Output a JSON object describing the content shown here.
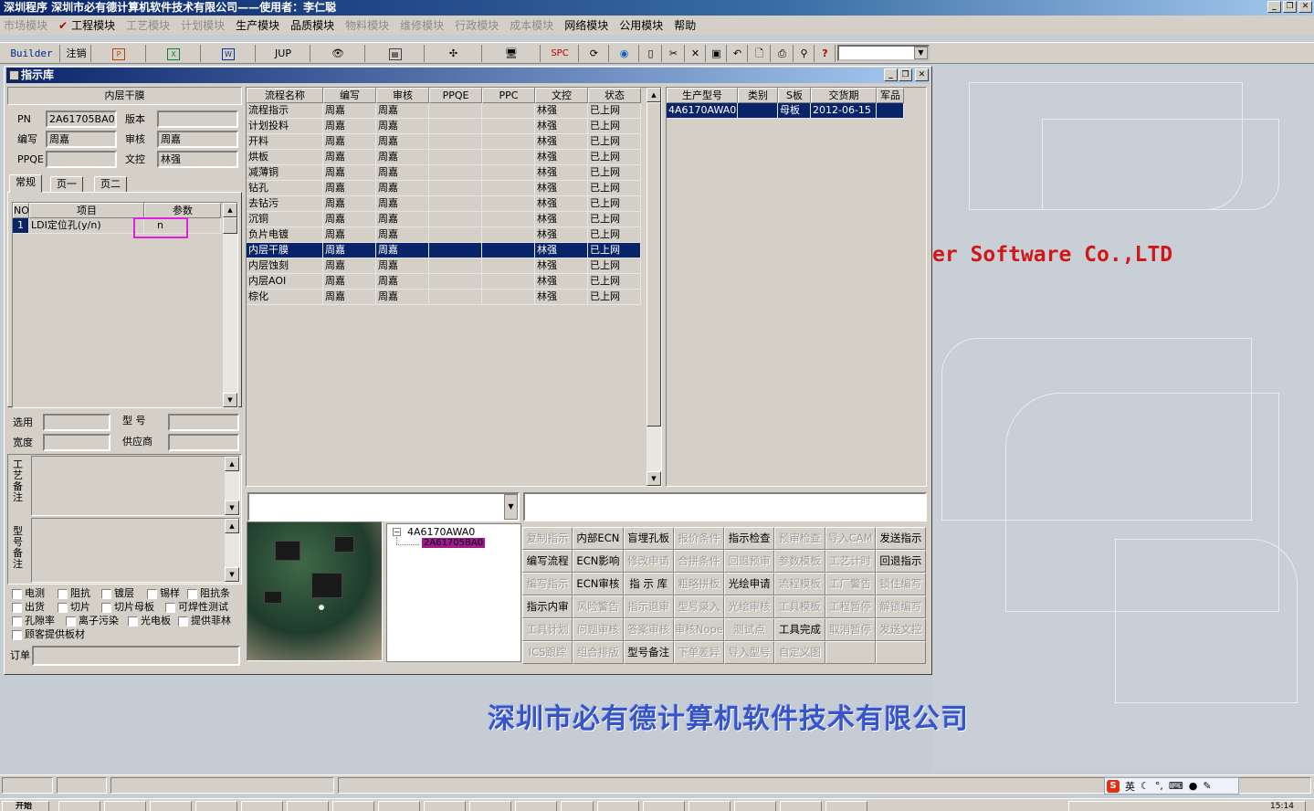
{
  "app": {
    "title": "深圳程序    深圳市必有德计算机软件技术有限公司——使用者：李仁聪"
  },
  "menu": {
    "items": [
      {
        "label": "市场模块",
        "disabled": true
      },
      {
        "label": "工程模块",
        "disabled": false,
        "checked": true
      },
      {
        "label": "工艺模块",
        "disabled": true
      },
      {
        "label": "计划模块",
        "disabled": true
      },
      {
        "label": "生产模块",
        "disabled": false
      },
      {
        "label": "品质模块",
        "disabled": false
      },
      {
        "label": "物料模块",
        "disabled": true
      },
      {
        "label": "维修模块",
        "disabled": true
      },
      {
        "label": "行政模块",
        "disabled": true
      },
      {
        "label": "成本模块",
        "disabled": true
      },
      {
        "label": "网络模块",
        "disabled": false
      },
      {
        "label": "公用模块",
        "disabled": false
      },
      {
        "label": "帮助",
        "disabled": false
      }
    ]
  },
  "toolbar": {
    "builder": "Builder",
    "logout": "注销",
    "jup": "JUP",
    "spc": "SPC"
  },
  "window": {
    "title": "指示库"
  },
  "left": {
    "section_title": "内层干膜",
    "pn_label": "PN",
    "pn_value": "2A61705BA0",
    "version_label": "版本",
    "version_value": "",
    "author_label": "编写",
    "author_value": "周嘉",
    "review_label": "审核",
    "review_value": "周嘉",
    "ppqe_label": "PPQE",
    "ppqe_value": "",
    "doc_label": "文控",
    "doc_value": "林强",
    "tabs": [
      "常规",
      "页一",
      "页二"
    ],
    "param_headers": [
      "NO",
      "项目",
      "参数"
    ],
    "param_rows": [
      {
        "no": "1",
        "item": "LDI定位孔(y/n)",
        "param": "n"
      }
    ],
    "select_label": "选用",
    "model_label": "型 号",
    "width_label": "宽度",
    "supplier_label": "供应商",
    "process_note_label": "工艺备注",
    "model_note_label": "型号备注",
    "checkboxes": [
      "电测",
      "阻抗",
      "镀层",
      "锡样",
      "阻抗条",
      "出货",
      "切片",
      "切片母板",
      "可焊性测试",
      "孔隙率",
      "离子污染",
      "光电板",
      "提供菲林",
      "顾客提供板材"
    ],
    "order_label": "订单"
  },
  "process_grid": {
    "headers": [
      "流程名称",
      "编写",
      "审核",
      "PPQE",
      "PPC",
      "文控",
      "状态"
    ],
    "rows": [
      [
        "流程指示",
        "周嘉",
        "周嘉",
        "",
        "",
        "林强",
        "已上网"
      ],
      [
        "计划投料",
        "周嘉",
        "周嘉",
        "",
        "",
        "林强",
        "已上网"
      ],
      [
        "开料",
        "周嘉",
        "周嘉",
        "",
        "",
        "林强",
        "已上网"
      ],
      [
        "烘板",
        "周嘉",
        "周嘉",
        "",
        "",
        "林强",
        "已上网"
      ],
      [
        "减薄铜",
        "周嘉",
        "周嘉",
        "",
        "",
        "林强",
        "已上网"
      ],
      [
        "钻孔",
        "周嘉",
        "周嘉",
        "",
        "",
        "林强",
        "已上网"
      ],
      [
        "去钻污",
        "周嘉",
        "周嘉",
        "",
        "",
        "林强",
        "已上网"
      ],
      [
        "沉铜",
        "周嘉",
        "周嘉",
        "",
        "",
        "林强",
        "已上网"
      ],
      [
        "负片电镀",
        "周嘉",
        "周嘉",
        "",
        "",
        "林强",
        "已上网"
      ],
      [
        "内层干膜",
        "周嘉",
        "周嘉",
        "",
        "",
        "林强",
        "已上网"
      ],
      [
        "内层蚀刻",
        "周嘉",
        "周嘉",
        "",
        "",
        "林强",
        "已上网"
      ],
      [
        "内层AOI",
        "周嘉",
        "周嘉",
        "",
        "",
        "林强",
        "已上网"
      ],
      [
        "棕化",
        "周嘉",
        "周嘉",
        "",
        "",
        "林强",
        "已上网"
      ]
    ],
    "selected_index": 9
  },
  "product_grid": {
    "headers": [
      "生产型号",
      "类别",
      "S板",
      "交货期",
      "军品"
    ],
    "rows": [
      [
        "4A6170AWA0",
        "",
        "母板",
        "2012-06-15",
        ""
      ]
    ]
  },
  "tree": {
    "root": "4A6170AWA0",
    "child": "2A61705BA0"
  },
  "buttons": [
    {
      "label": "复制指示",
      "enabled": false
    },
    {
      "label": "内部ECN",
      "enabled": true
    },
    {
      "label": "盲埋孔板",
      "enabled": true
    },
    {
      "label": "报价条件",
      "enabled": false
    },
    {
      "label": "指示检查",
      "enabled": true
    },
    {
      "label": "预审检查",
      "enabled": false
    },
    {
      "label": "导入CAM",
      "enabled": false
    },
    {
      "label": "发送指示",
      "enabled": true
    },
    {
      "label": "编写流程",
      "enabled": true
    },
    {
      "label": "ECN影响",
      "enabled": true
    },
    {
      "label": "修改申请",
      "enabled": false
    },
    {
      "label": "合拼条件",
      "enabled": false
    },
    {
      "label": "回退预审",
      "enabled": false
    },
    {
      "label": "参数模板",
      "enabled": false
    },
    {
      "label": "工艺计时",
      "enabled": false
    },
    {
      "label": "回退指示",
      "enabled": true
    },
    {
      "label": "编写指示",
      "enabled": false
    },
    {
      "label": "ECN审核",
      "enabled": true
    },
    {
      "label": "指 示 库",
      "enabled": true
    },
    {
      "label": "粗略拼板",
      "enabled": false
    },
    {
      "label": "光绘申请",
      "enabled": true
    },
    {
      "label": "流程模板",
      "enabled": false
    },
    {
      "label": "工厂警告",
      "enabled": false
    },
    {
      "label": "锁住编写",
      "enabled": false
    },
    {
      "label": "指示内审",
      "enabled": true
    },
    {
      "label": "风险警告",
      "enabled": false
    },
    {
      "label": "指示退审",
      "enabled": false
    },
    {
      "label": "型号录入",
      "enabled": false
    },
    {
      "label": "光绘审核",
      "enabled": false
    },
    {
      "label": "工具模板",
      "enabled": false
    },
    {
      "label": "工程暂停",
      "enabled": false
    },
    {
      "label": "解锁编写",
      "enabled": false
    },
    {
      "label": "工具计划",
      "enabled": false
    },
    {
      "label": "问题审核",
      "enabled": false
    },
    {
      "label": "答案审核",
      "enabled": false
    },
    {
      "label": "审核Nope",
      "enabled": false
    },
    {
      "label": "测试点",
      "enabled": false
    },
    {
      "label": "工具完成",
      "enabled": true
    },
    {
      "label": "取消暂停",
      "enabled": false
    },
    {
      "label": "发送文控",
      "enabled": false
    },
    {
      "label": "ICS跟踪",
      "enabled": false
    },
    {
      "label": "组合排版",
      "enabled": false
    },
    {
      "label": "型号备注",
      "enabled": true
    },
    {
      "label": "下单差异",
      "enabled": false
    },
    {
      "label": "导入型号",
      "enabled": false
    },
    {
      "label": "自定义图",
      "enabled": false
    },
    {
      "label": "",
      "enabled": false
    },
    {
      "label": "",
      "enabled": false
    }
  ],
  "desktop": {
    "brand_en": "er Software Co.,LTD",
    "brand_cn": "深圳市必有德计算机软件技术有限公司"
  },
  "taskbar": {
    "start": "开始",
    "clock": "15:14"
  },
  "ime": {
    "mode": "英"
  },
  "colors": {
    "selection": "#0a246a",
    "brand_red": "#d01818",
    "brand_blue": "#3855c8",
    "highlight_box": "#e020e0",
    "tree_child_bg": "#a01890"
  }
}
